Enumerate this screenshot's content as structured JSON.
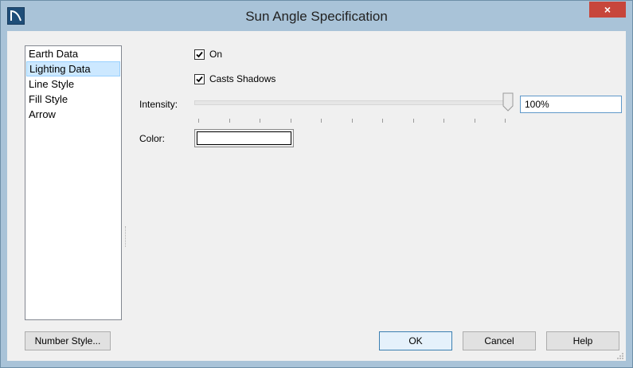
{
  "window": {
    "title": "Sun Angle Specification",
    "close_glyph": "×"
  },
  "sidebar": {
    "items": [
      {
        "label": "Earth Data",
        "selected": false
      },
      {
        "label": "Lighting Data",
        "selected": true
      },
      {
        "label": "Line Style",
        "selected": false
      },
      {
        "label": "Fill Style",
        "selected": false
      },
      {
        "label": "Arrow",
        "selected": false
      }
    ]
  },
  "lighting": {
    "on_label": "On",
    "on_checked": true,
    "shadows_label": "Casts Shadows",
    "shadows_checked": true,
    "intensity_label": "Intensity:",
    "intensity_value": "100%",
    "intensity_fraction": 1.0,
    "color_label": "Color:",
    "color_value": "#ffffff"
  },
  "buttons": {
    "number_style": "Number Style...",
    "ok": "OK",
    "cancel": "Cancel",
    "help": "Help"
  },
  "colors": {
    "titlebar": "#a9c3d8",
    "close": "#c7463b",
    "selection": "#cce8ff"
  },
  "icons": {
    "app": "app-logo-icon",
    "close": "close-icon",
    "check": "checkmark-icon",
    "grip": "resize-grip-icon"
  }
}
